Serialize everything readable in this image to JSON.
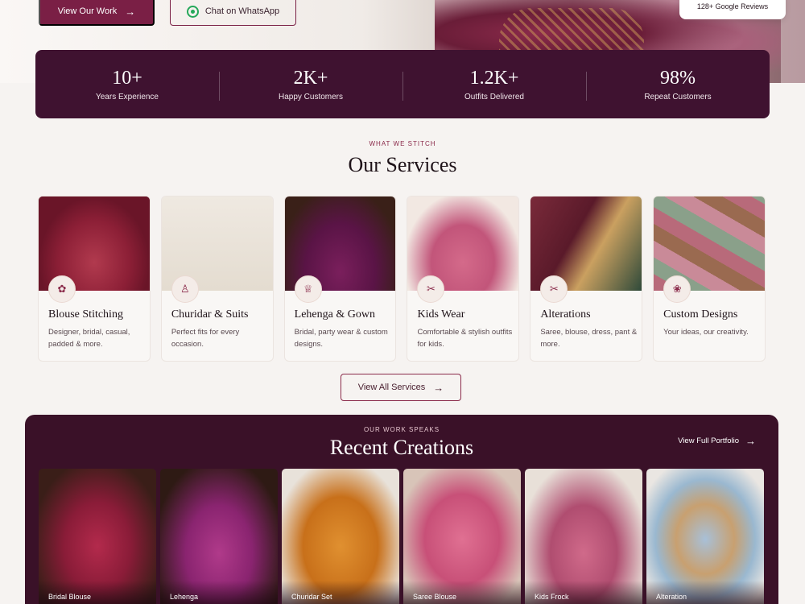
{
  "hero": {
    "view_work_label": "View Our Work",
    "whatsapp_label": "Chat on WhatsApp",
    "reviews_text": "128+ Google Reviews"
  },
  "stats": [
    {
      "value": "10+",
      "label": "Years Experience"
    },
    {
      "value": "2K+",
      "label": "Happy Customers"
    },
    {
      "value": "1.2K+",
      "label": "Outfits Delivered"
    },
    {
      "value": "98%",
      "label": "Repeat Customers"
    }
  ],
  "services": {
    "eyebrow": "WHAT WE STITCH",
    "title": "Our Services",
    "items": [
      {
        "name": "Blouse Stitching",
        "desc": "Designer, bridal, casual, padded & more.",
        "icon": "blouse-icon"
      },
      {
        "name": "Churidar & Suits",
        "desc": "Perfect fits for every occasion.",
        "icon": "suit-icon"
      },
      {
        "name": "Lehenga & Gown",
        "desc": "Bridal, party wear & custom designs.",
        "icon": "gown-icon"
      },
      {
        "name": "Kids Wear",
        "desc": "Comfortable & stylish outfits for kids.",
        "icon": "kids-icon"
      },
      {
        "name": "Alterations",
        "desc": "Saree, blouse, dress, pant & more.",
        "icon": "scissors-icon"
      },
      {
        "name": "Custom Designs",
        "desc": "Your ideas, our creativity.",
        "icon": "design-icon"
      }
    ],
    "view_all_label": "View All Services"
  },
  "portfolio": {
    "eyebrow": "OUR WORK SPEAKS",
    "title": "Recent Creations",
    "view_full_label": "View Full Portfolio",
    "items": [
      {
        "caption": "Bridal Blouse"
      },
      {
        "caption": "Lehenga"
      },
      {
        "caption": "Churidar Set"
      },
      {
        "caption": "Saree Blouse"
      },
      {
        "caption": "Kids Frock"
      },
      {
        "caption": "Alteration"
      }
    ]
  },
  "colors": {
    "brand": "#7a1f45",
    "stats_bg": "#3f1230",
    "portfolio_bg": "#3a1128",
    "background": "#f6f3f1"
  }
}
